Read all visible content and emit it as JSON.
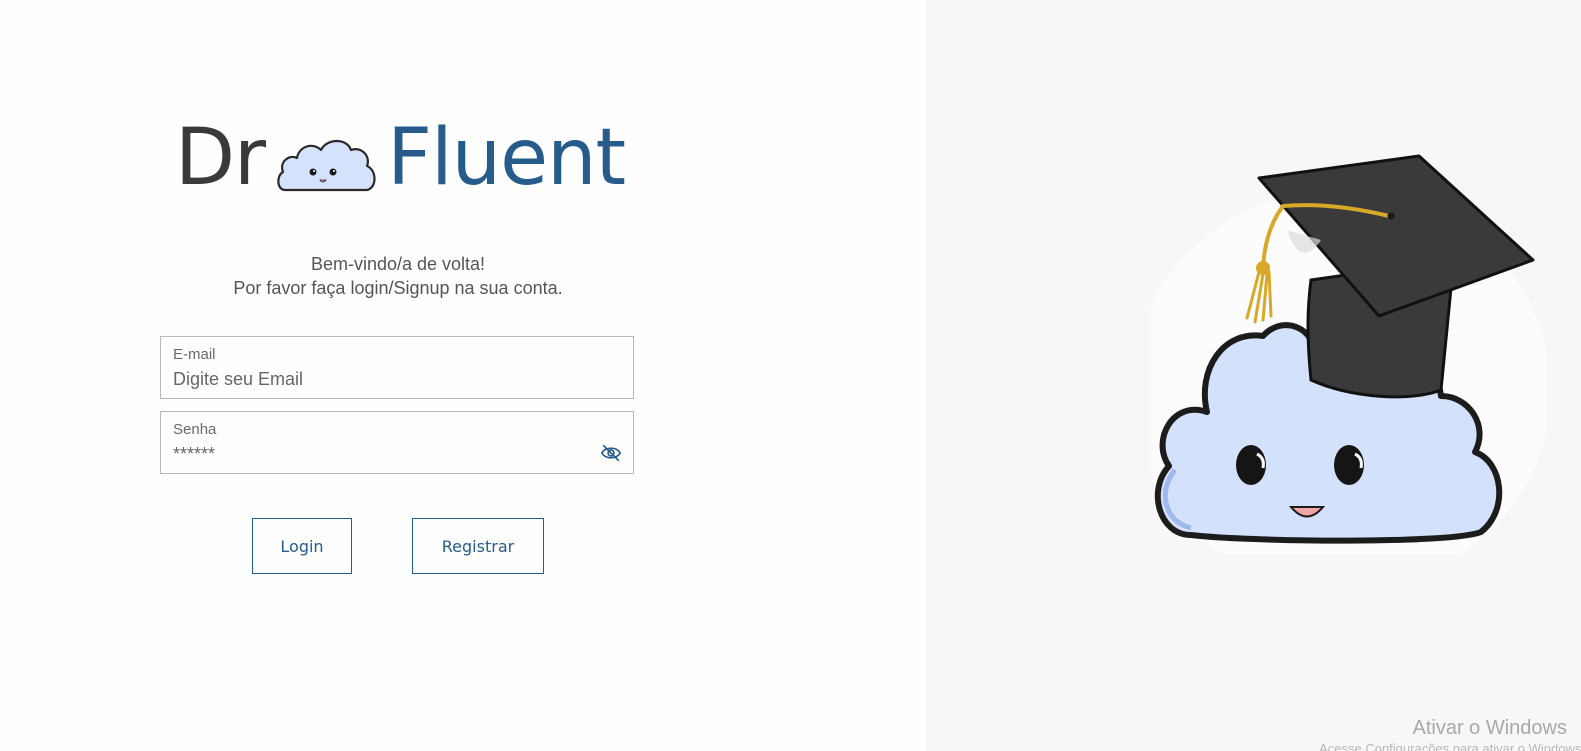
{
  "logo": {
    "part1": "Dr",
    "part2": "Fluent",
    "colors": {
      "dark": "#3a3a3a",
      "brand": "#275b8c",
      "cloud": "#d5e2fb"
    }
  },
  "welcome": {
    "line1": "Bem-vindo/a de volta!",
    "line2": "Por favor faça login/Signup na sua conta."
  },
  "form": {
    "email": {
      "label": "E-mail",
      "placeholder": "Digite seu Email",
      "value": ""
    },
    "password": {
      "label": "Senha",
      "placeholder": "******",
      "value": "",
      "toggle_icon": "eye-off-icon"
    }
  },
  "buttons": {
    "login_label": "Login",
    "register_label": "Registrar"
  },
  "watermark": {
    "title": "Ativar o Windows",
    "subtitle": "Acesse Configurações para ativar o Windows."
  }
}
